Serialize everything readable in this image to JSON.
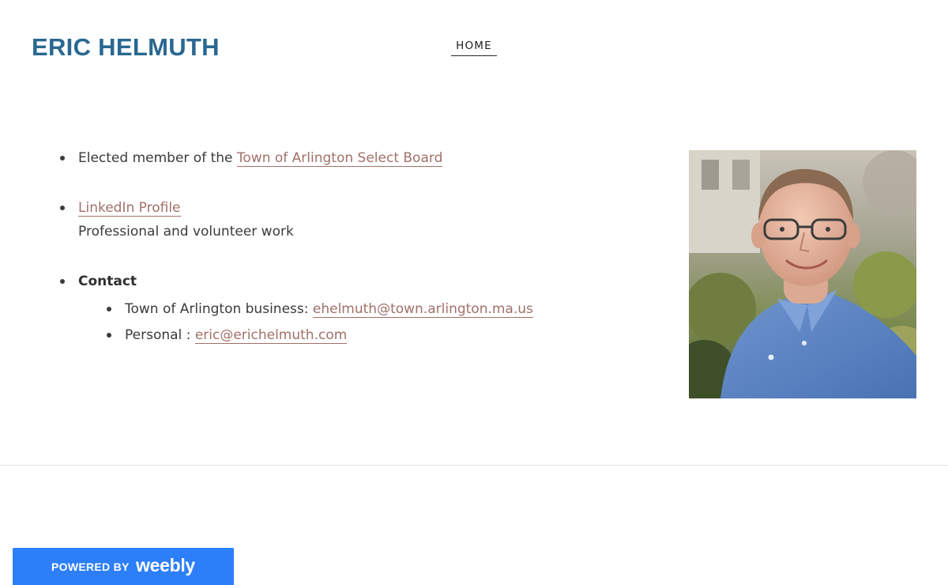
{
  "header": {
    "site_title": "ERIC HELMUTH",
    "nav": [
      {
        "label": "HOME",
        "active": true
      }
    ]
  },
  "main": {
    "items": [
      {
        "prefix": "Elected member of the ",
        "link_text": "Town of Arlington Select Board"
      },
      {
        "link_text": "LinkedIn Profile",
        "description": "Professional and volunteer work"
      },
      {
        "heading": "Contact",
        "sub_items": [
          {
            "label": "Town of Arlington business: ",
            "link_text": "ehelmuth@town.arlington.ma.us"
          },
          {
            "label": "Personal : ",
            "link_text": "eric@erichelmuth.com"
          }
        ]
      }
    ],
    "photo_alt": "Portrait photo of Eric Helmuth"
  },
  "footer": {
    "badge_powered": "POWERED BY",
    "badge_brand": "weebly"
  },
  "colors": {
    "title": "#296891",
    "link": "#a0706a",
    "text": "#3b3b3b",
    "badge": "#2d7ff9"
  }
}
